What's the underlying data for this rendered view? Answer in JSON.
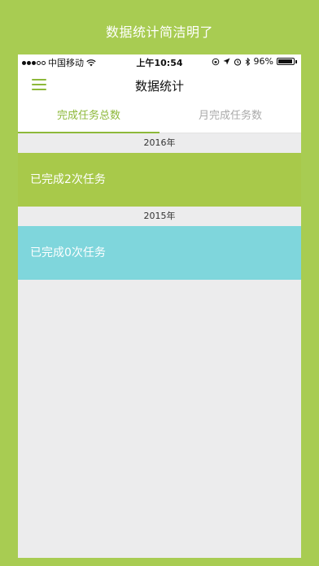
{
  "promo": {
    "caption": "数据统计简洁明了"
  },
  "status_bar": {
    "carrier": "中国移动",
    "time": "上午10:54",
    "battery": "96%",
    "battery_level": 0.96
  },
  "nav": {
    "title": "数据统计"
  },
  "tabs": [
    {
      "label": "完成任务总数",
      "active": true
    },
    {
      "label": "月完成任务数",
      "active": false
    }
  ],
  "years": [
    {
      "year": "2016年",
      "summary": "已完成2次任务",
      "color": "#a8c94a"
    },
    {
      "year": "2015年",
      "summary": "已完成0次任务",
      "color": "#7fd6dc"
    }
  ],
  "colors": {
    "frame": "#a8cc52",
    "accent": "#8db83a",
    "inactive_tab": "#aaaaaa",
    "background": "#ececed"
  },
  "icons": {
    "menu": "hamburger-menu-icon",
    "wifi": "wifi-icon",
    "bluetooth": "bluetooth-icon",
    "alarm": "alarm-icon",
    "location": "location-arrow-icon",
    "orientation_lock": "orientation-lock-icon"
  }
}
